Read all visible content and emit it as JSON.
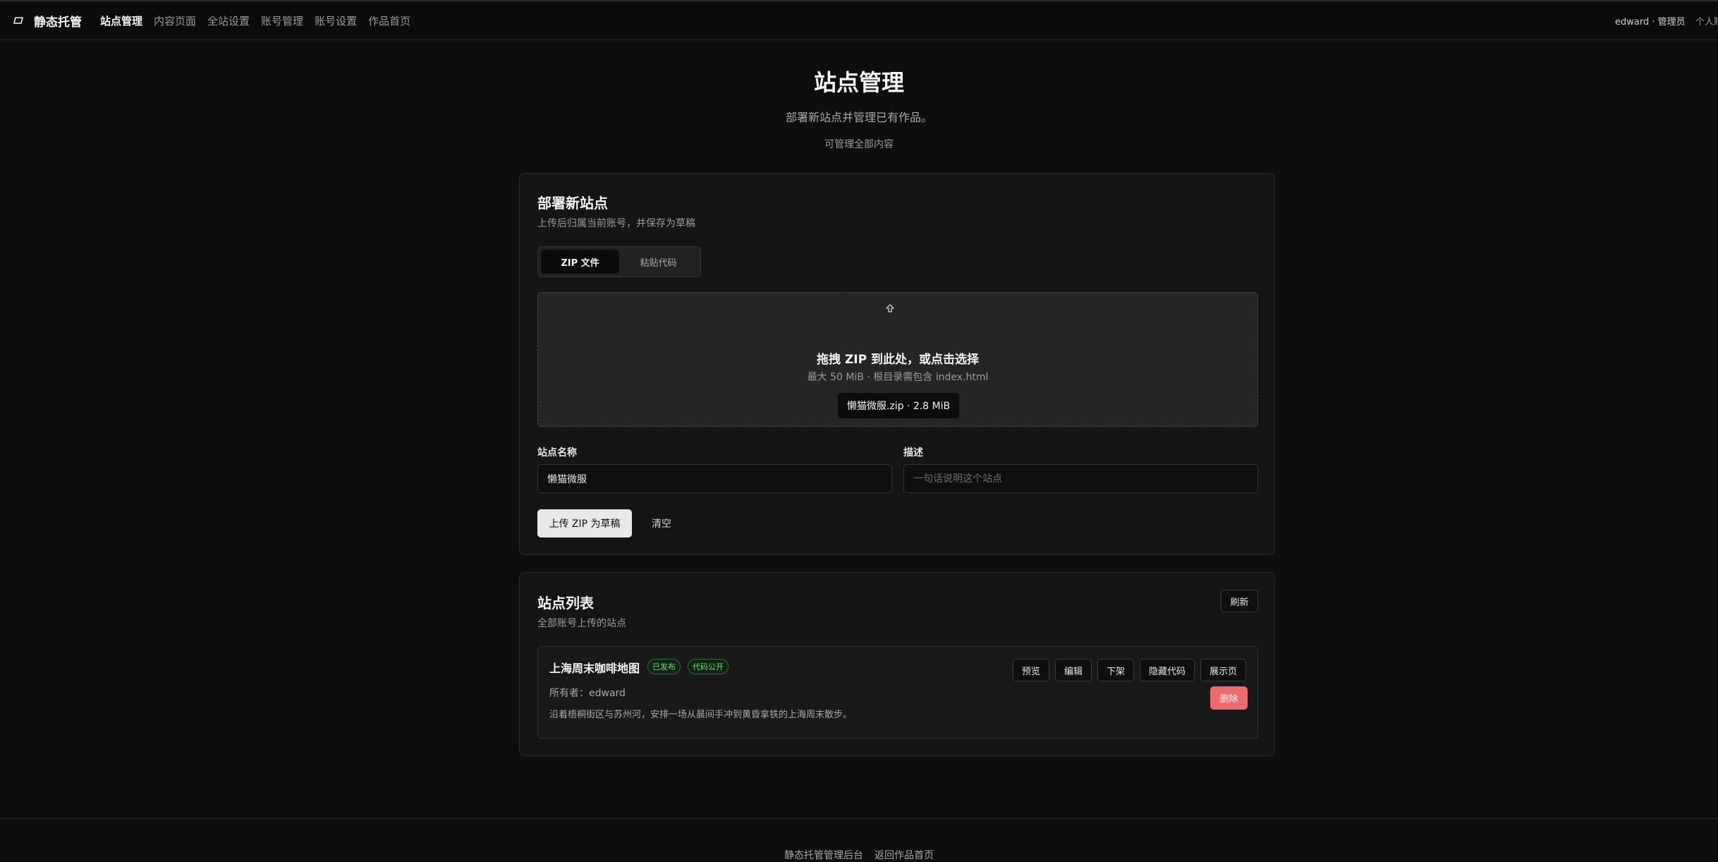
{
  "header": {
    "brand": "静态托管",
    "nav": [
      "站点管理",
      "内容页面",
      "全站设置",
      "账号管理",
      "账号设置",
      "作品首页"
    ],
    "user": "edward · 管理员",
    "profile": "个人账"
  },
  "page": {
    "title": "站点管理",
    "subtitle": "部署新站点并管理已有作品。",
    "note": "可管理全部内容"
  },
  "deploy": {
    "title": "部署新站点",
    "subtitle": "上传后归属当前账号，并保存为草稿",
    "tabs": [
      "ZIP 文件",
      "粘贴代码"
    ],
    "dropzone": {
      "title": "拖拽 ZIP 到此处，或点击选择",
      "hint": "最大 50 MiB · 根目录需包含 index.html",
      "file": "懒猫微服.zip · 2.8 MiB"
    },
    "name_label": "站点名称",
    "name_value": "懒猫微服",
    "desc_label": "描述",
    "desc_placeholder": "一句话说明这个站点",
    "upload_button": "上传 ZIP 为草稿",
    "clear_button": "清空"
  },
  "list": {
    "title": "站点列表",
    "subtitle": "全部账号上传的站点",
    "refresh": "刷新",
    "sites": [
      {
        "name": "上海周末咖啡地图",
        "badges": [
          "已发布",
          "代码公开"
        ],
        "owner": "所有者：edward",
        "description": "沿着梧桐街区与苏州河，安排一场从晨间手冲到黄昏拿铁的上海周末散步。",
        "actions": [
          "预览",
          "编辑",
          "下架",
          "隐藏代码",
          "展示页"
        ],
        "delete": "删除"
      }
    ]
  },
  "footer": {
    "links": [
      "静态托管管理后台",
      "返回作品首页"
    ]
  },
  "colors": {
    "background": "#0e0e0e",
    "card": "#151515",
    "danger": "#ef6a6a",
    "success": "#6fd77a"
  }
}
